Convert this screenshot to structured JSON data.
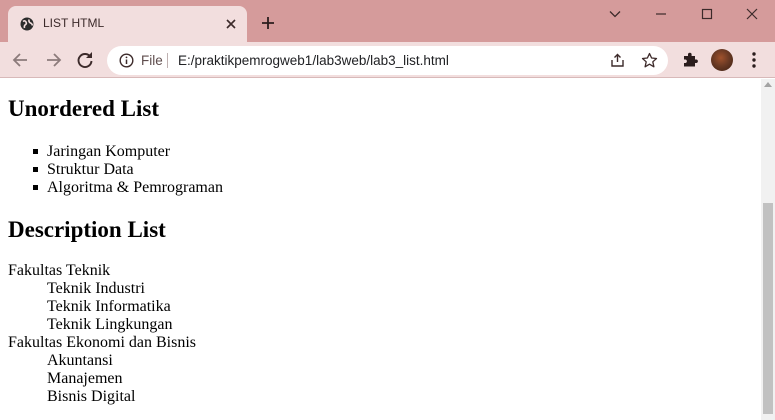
{
  "browser": {
    "tab_title": "LIST HTML",
    "url_scheme": "File",
    "url": "E:/praktikpemrogweb1/lab3web/lab3_list.html"
  },
  "page": {
    "unordered": {
      "heading": "Unordered List",
      "items": [
        "Jaringan Komputer",
        "Struktur Data",
        "Algoritma & Pemrograman"
      ]
    },
    "description": {
      "heading": "Description List",
      "groups": [
        {
          "term": "Fakultas Teknik",
          "details": [
            "Teknik Industri",
            "Teknik Informatika",
            "Teknik Lingkungan"
          ]
        },
        {
          "term": "Fakultas Ekonomi dan Bisnis",
          "details": [
            "Akuntansi",
            "Manajemen",
            "Bisnis Digital"
          ]
        }
      ]
    }
  },
  "colors": {
    "tabstrip": "#d59b9b",
    "toolbar": "#f2dede"
  }
}
